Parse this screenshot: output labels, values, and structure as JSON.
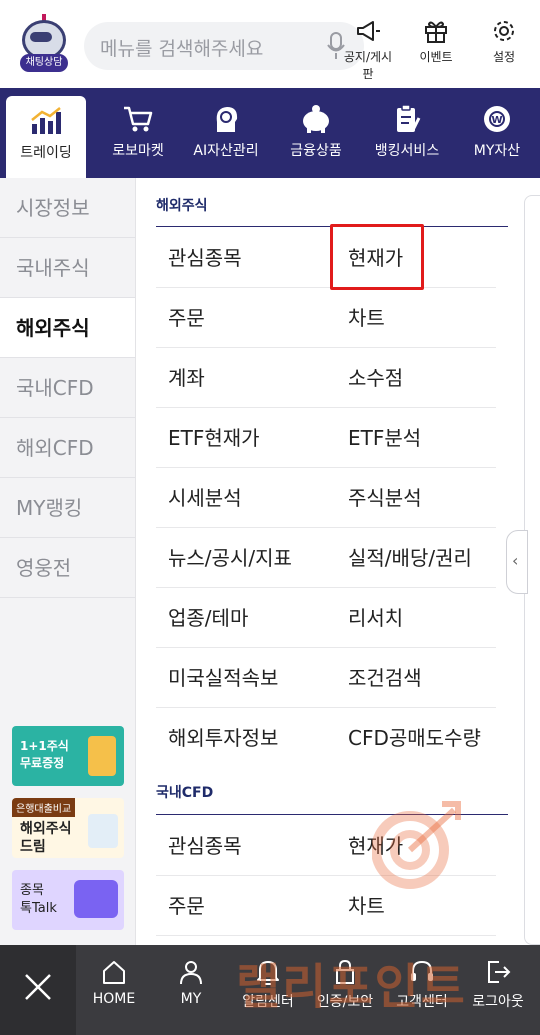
{
  "header": {
    "chatbot_label": "채팅상담",
    "search_placeholder": "메뉴를 검색해주세요",
    "icons": [
      {
        "name": "megaphone-icon",
        "label": "공지/게시판"
      },
      {
        "name": "gift-icon",
        "label": "이벤트"
      },
      {
        "name": "gear-icon",
        "label": "설정"
      }
    ]
  },
  "nav": {
    "items": [
      {
        "label": "트레이딩",
        "icon": "chart-icon",
        "active": true
      },
      {
        "label": "로보마켓",
        "icon": "cart-icon",
        "active": false
      },
      {
        "label": "AI자산관리",
        "icon": "ai-head-icon",
        "active": false
      },
      {
        "label": "금융상품",
        "icon": "piggy-bank-icon",
        "active": false
      },
      {
        "label": "뱅킹서비스",
        "icon": "document-icon",
        "active": false
      },
      {
        "label": "MY자산",
        "icon": "won-coin-icon",
        "active": false
      }
    ]
  },
  "left_menu": {
    "items": [
      "시장정보",
      "국내주식",
      "해외주식",
      "국내CFD",
      "해외CFD",
      "MY랭킹",
      "영웅전"
    ],
    "active": "해외주식",
    "promos": [
      {
        "line1": "1+1주식",
        "line2": "무료증정"
      },
      {
        "tag": "은행대출비교",
        "line1": "해외주식",
        "line2": "드림"
      },
      {
        "line1": "종목",
        "line2": "톡Talk"
      }
    ]
  },
  "content": {
    "section1_title": "해외주식",
    "section1_rows": [
      [
        "관심종목",
        "현재가"
      ],
      [
        "주문",
        "차트"
      ],
      [
        "계좌",
        "소수점"
      ],
      [
        "ETF현재가",
        "ETF분석"
      ],
      [
        "시세분석",
        "주식분석"
      ],
      [
        "뉴스/공시/지표",
        "실적/배당/권리"
      ],
      [
        "업종/테마",
        "리서치"
      ],
      [
        "미국실적속보",
        "조건검색"
      ],
      [
        "해외투자정보",
        "CFD공매도수량"
      ]
    ],
    "section2_title": "국내CFD",
    "section2_rows": [
      [
        "관심종목",
        "현재가"
      ],
      [
        "주문",
        "차트"
      ]
    ]
  },
  "bottom_bar": {
    "items": [
      {
        "label": "HOME",
        "icon": "home-icon"
      },
      {
        "label": "MY",
        "icon": "person-icon"
      },
      {
        "label": "알림센터",
        "icon": "bell-icon"
      },
      {
        "label": "인증/보안",
        "icon": "lock-icon"
      },
      {
        "label": "고객센터",
        "icon": "headset-icon"
      },
      {
        "label": "로그아웃",
        "icon": "logout-icon"
      }
    ]
  },
  "watermark": "랠리포인트",
  "colors": {
    "nav_bg": "#2b2a70",
    "highlight": "#e11b1b",
    "bottom_bg": "#3b3b3f"
  }
}
